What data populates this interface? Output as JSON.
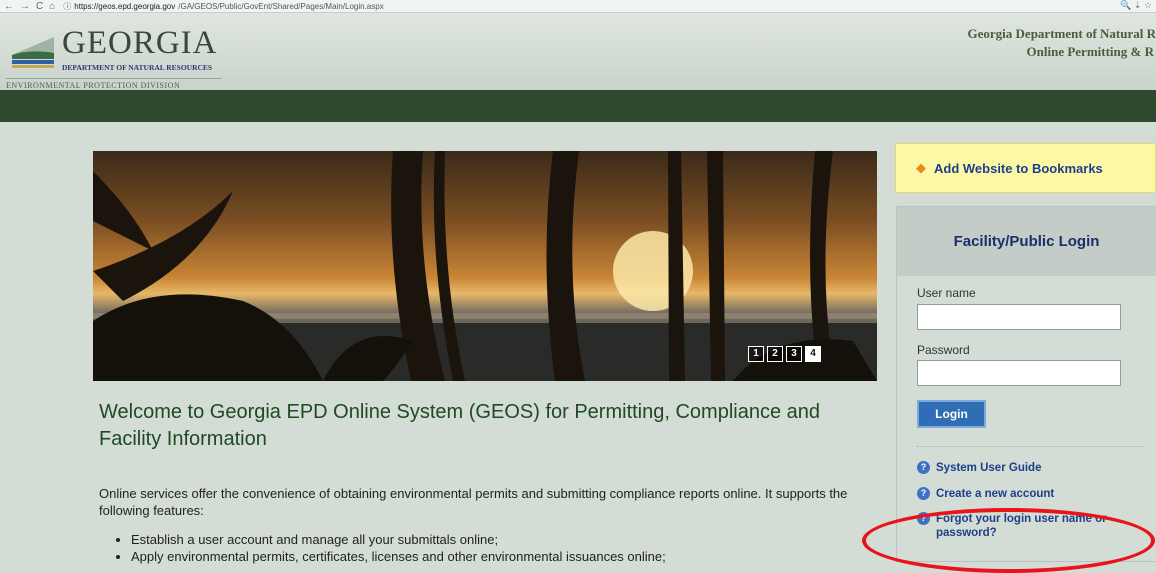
{
  "browser": {
    "back_icon": "←",
    "forward_icon": "→",
    "reload_icon": "C",
    "home_icon": "⌂",
    "info_icon": "ⓘ",
    "url_host": "https://geos.epd.georgia.gov",
    "url_path": "/GA/GEOS/Public/GovEnt/Shared/Pages/Main/Login.aspx",
    "right_icons": "🔍 ⇣ ☆"
  },
  "header": {
    "logo_big": "GEORGIA",
    "logo_dnr": "DEPARTMENT OF NATURAL RESOURCES",
    "logo_epd": "ENVIRONMENTAL PROTECTION DIVISION",
    "dept_line1": "Georgia Department of Natural R",
    "dept_line2": "Online Permitting & R"
  },
  "slideshow": {
    "slides": [
      "1",
      "2",
      "3",
      "4"
    ],
    "active_slide": "4"
  },
  "main": {
    "welcome": "Welcome to Georgia EPD Online System (GEOS) for Permitting, Compliance and Facility Information",
    "intro": "Online services offer the convenience of obtaining environmental permits and submitting compliance reports online. It supports the following features:",
    "features": [
      "Establish a user account and manage all your submittals online;",
      "Apply environmental permits, certificates, licenses and other environmental issuances online;"
    ]
  },
  "sidebar": {
    "bookmark_label": "Add Website to Bookmarks",
    "login_title": "Facility/Public Login",
    "username_label": "User name",
    "password_label": "Password",
    "login_button": "Login",
    "links": [
      "System User Guide",
      "Create a new account",
      "Forgot your login user name or password?"
    ]
  },
  "colors": {
    "navbar": "#2e4a2e",
    "link": "#1d3f8a",
    "highlight_ellipse": "#e8141c",
    "bookmark_bg": "#fdf8a6",
    "login_button": "#2f6db5"
  }
}
